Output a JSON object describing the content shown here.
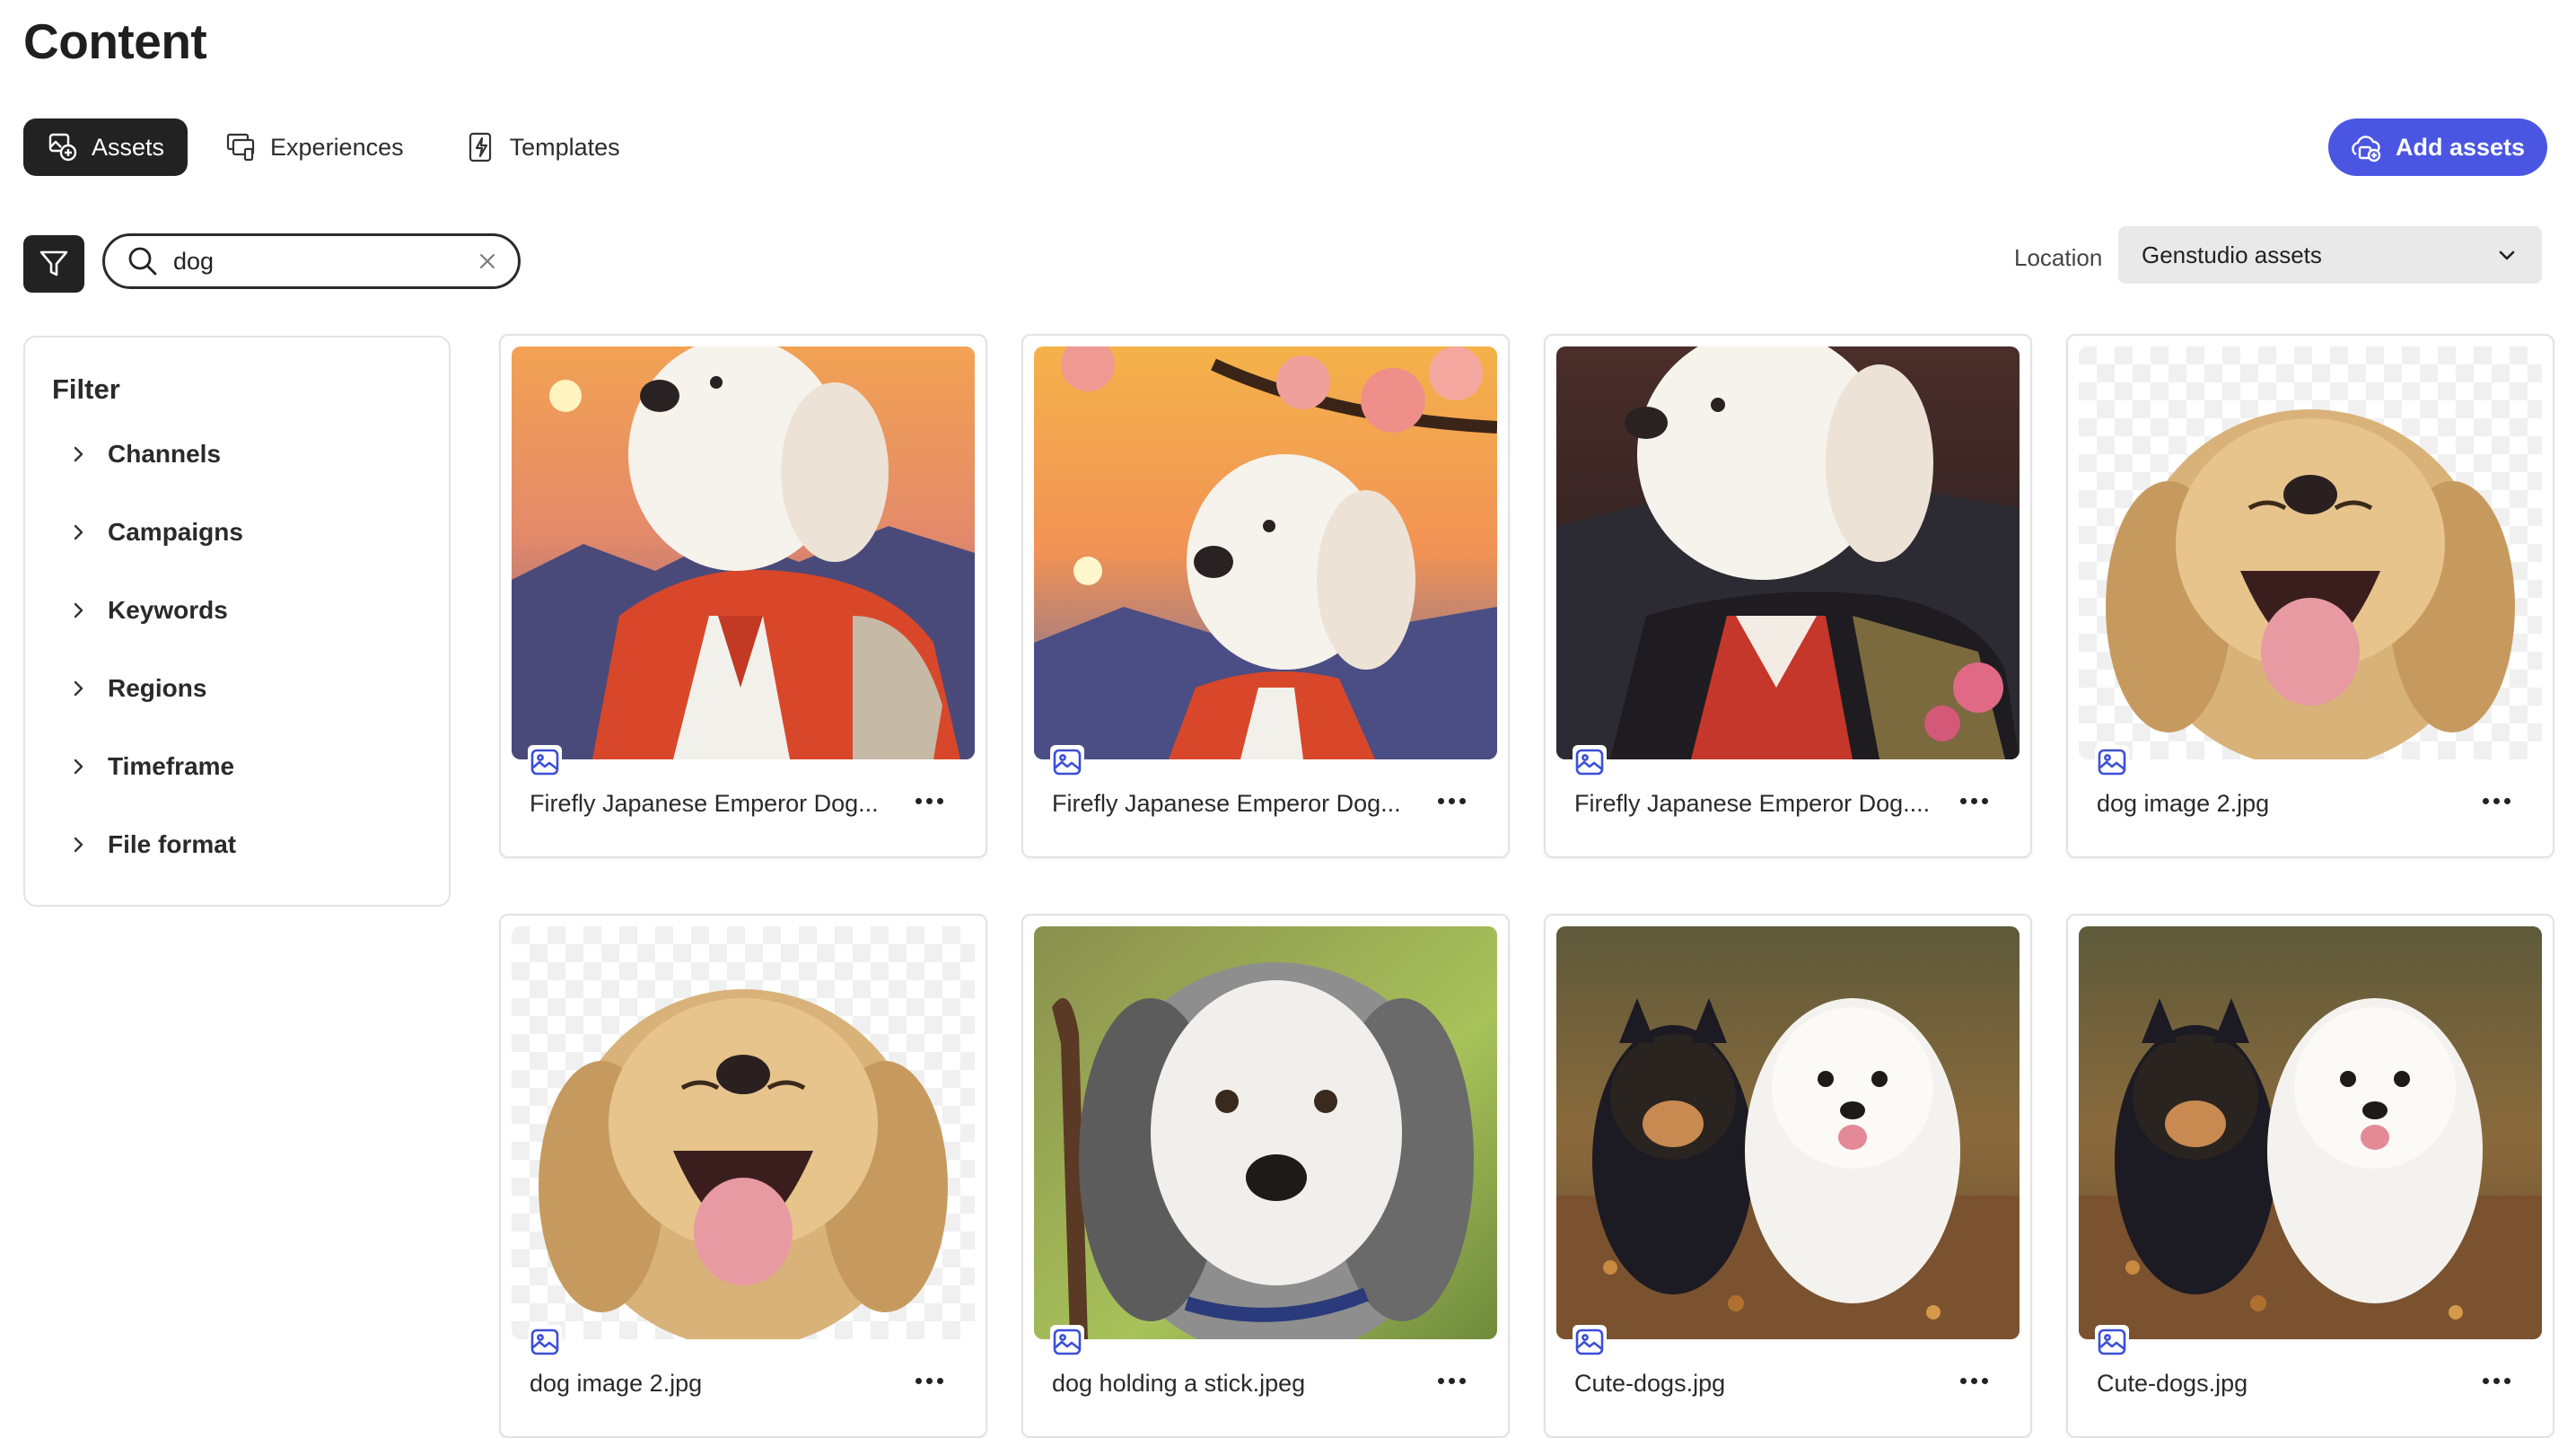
{
  "page": {
    "title": "Content"
  },
  "tabs": [
    {
      "label": "Assets",
      "icon": "assets-icon",
      "active": true
    },
    {
      "label": "Experiences",
      "icon": "experiences-icon",
      "active": false
    },
    {
      "label": "Templates",
      "icon": "templates-icon",
      "active": false
    }
  ],
  "toolbar": {
    "add_assets_label": "Add assets",
    "search_value": "dog",
    "location_label": "Location",
    "location_value": "Genstudio assets"
  },
  "filter": {
    "title": "Filter",
    "items": [
      "Channels",
      "Campaigns",
      "Keywords",
      "Regions",
      "Timeframe",
      "File format"
    ]
  },
  "assets": [
    {
      "name": "Firefly Japanese Emperor Dog...",
      "thumbnail": "dog-kimono-sunset"
    },
    {
      "name": "Firefly Japanese Emperor Dog...",
      "thumbnail": "dog-kimono-blossom"
    },
    {
      "name": "Firefly Japanese Emperor Dog....",
      "thumbnail": "dog-kimono-dark"
    },
    {
      "name": "dog image 2.jpg",
      "thumbnail": "puppy-laughing"
    },
    {
      "name": "dog image 2.jpg",
      "thumbnail": "puppy-laughing"
    },
    {
      "name": "dog holding a stick.jpeg",
      "thumbnail": "dog-with-stick"
    },
    {
      "name": "Cute-dogs.jpg",
      "thumbnail": "two-puppies"
    },
    {
      "name": "Cute-dogs.jpg",
      "thumbnail": "two-puppies"
    }
  ],
  "colors": {
    "accent": "#4a56e2",
    "dark": "#222222",
    "select_bg": "#e9e9e9"
  }
}
